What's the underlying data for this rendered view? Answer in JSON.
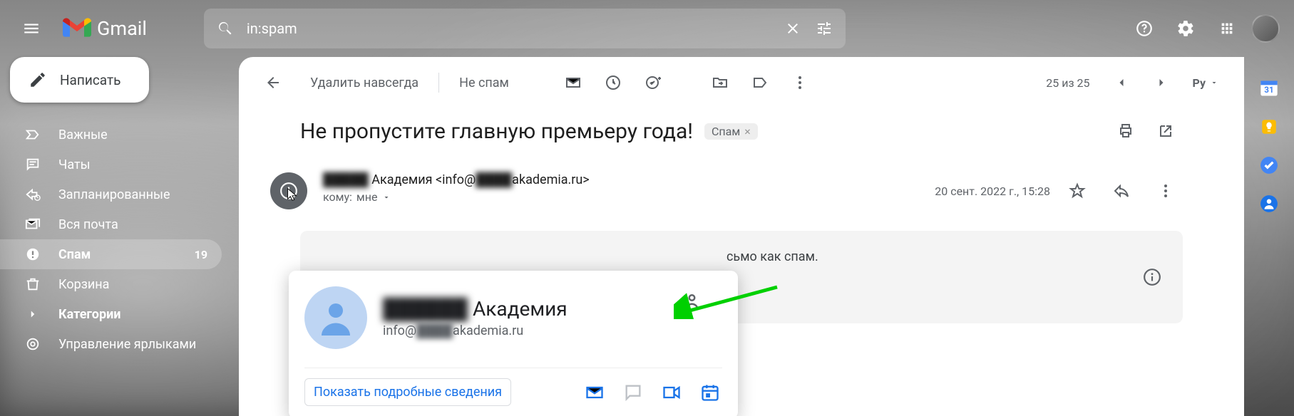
{
  "app": {
    "name": "Gmail"
  },
  "search": {
    "value": "in:spam"
  },
  "compose": {
    "label": "Написать"
  },
  "sidebar": {
    "items": [
      {
        "label": "Важные"
      },
      {
        "label": "Чаты"
      },
      {
        "label": "Запланированные"
      },
      {
        "label": "Вся почта"
      },
      {
        "label": "Спам",
        "count": "19"
      },
      {
        "label": "Корзина"
      },
      {
        "label": "Категории"
      },
      {
        "label": "Управление ярлыками"
      }
    ]
  },
  "toolbar": {
    "delete_forever": "Удалить навсегда",
    "not_spam": "Не спам",
    "count": "25 из 25",
    "input_mode": "Ру"
  },
  "subject": {
    "text": "Не пропустите главную премьеру года!",
    "chip": "Спам"
  },
  "sender": {
    "name_blur": "█████",
    "name_suffix": "Академия",
    "email_prefix": "<info@",
    "email_blur": "████",
    "email_suffix": "akademia.ru>",
    "to_prefix": "кому:",
    "to_value": "мне"
  },
  "meta": {
    "date": "20 сент. 2022 г., 15:28"
  },
  "banner": {
    "partial": "сьмо как спам."
  },
  "contact_card": {
    "name_blur": "██████",
    "name_suffix": "Академия",
    "email_prefix": "info@",
    "email_blur": "████",
    "email_suffix": "akademia.ru",
    "details_link": "Показать подробные сведения"
  },
  "sidepanel": {
    "calendar_day": "31"
  }
}
